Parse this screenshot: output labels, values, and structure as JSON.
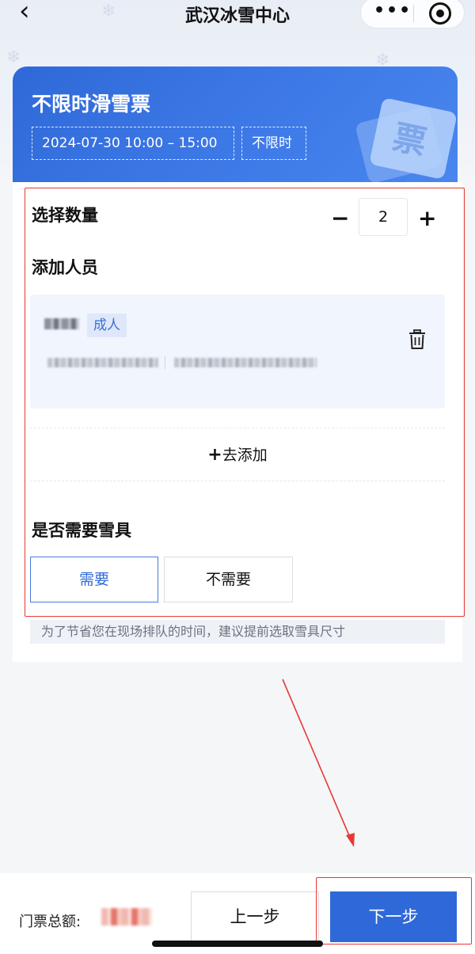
{
  "nav": {
    "title": "武汉冰雪中心",
    "more_glyph": "•••"
  },
  "ticket": {
    "name": "不限时滑雪票",
    "time": "2024-07-30 10:00 – 15:00",
    "duration": "不限时",
    "art_glyph": "票"
  },
  "quantity": {
    "label": "选择数量",
    "value": "2",
    "minus": "−",
    "plus": "+"
  },
  "people": {
    "label": "添加人员",
    "persons": [
      {
        "type_badge": "成人"
      }
    ],
    "add_link_plus": "+",
    "add_link_label": "去添加"
  },
  "equipment": {
    "label": "是否需要雪具",
    "options": [
      "需要",
      "不需要"
    ],
    "selected": "需要",
    "tip": "为了节省您在现场排队的时间，建议提前选取雪具尺寸"
  },
  "footer": {
    "total_label": "门票总额:",
    "prev_label": "上一步",
    "next_label": "下一步"
  },
  "colors": {
    "primary": "#2f69d9",
    "annotation_red": "#e53935"
  }
}
